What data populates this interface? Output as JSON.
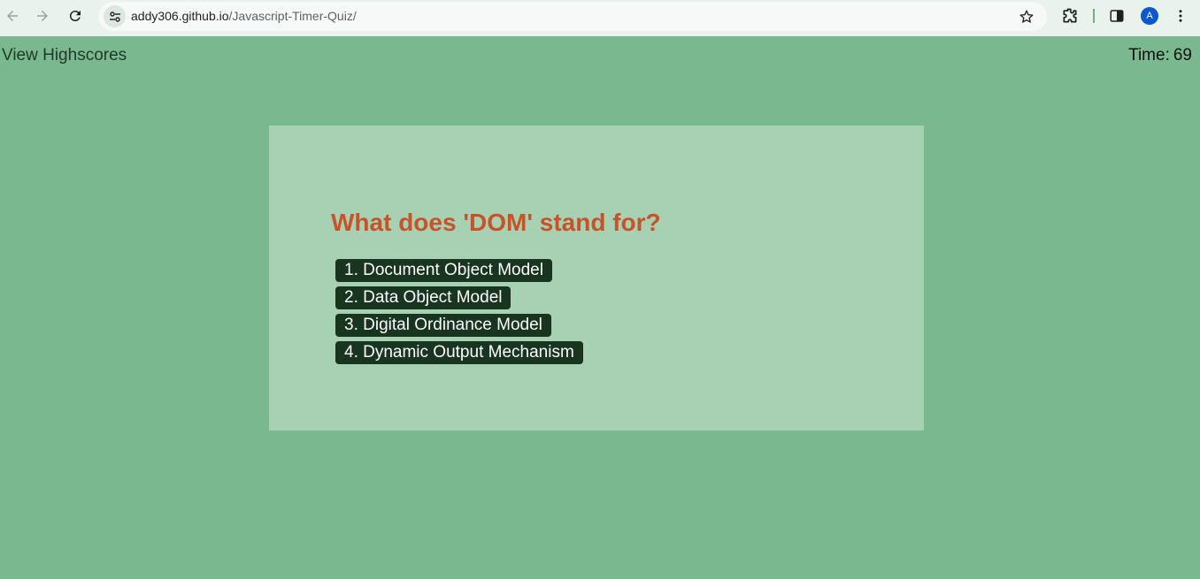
{
  "browser": {
    "url_host": "addy306.github.io",
    "url_path": "/Javascript-Timer-Quiz/",
    "avatar_letter": "A",
    "icons": [
      "back-arrow-icon",
      "forward-arrow-icon",
      "reload-icon",
      "site-info-icon",
      "bookmark-star-icon",
      "extensions-icon",
      "side-panel-icon",
      "profile-avatar",
      "more-menu-icon"
    ]
  },
  "header": {
    "highscores_link": "View Highscores",
    "timer_label": "Time:",
    "timer_value": "69"
  },
  "quiz": {
    "question": "What does 'DOM' stand for?",
    "choices": [
      "1. Document Object Model",
      "2. Data Object Model",
      "3. Digital Ordinance Model",
      "4. Dynamic Output Mechanism"
    ]
  },
  "colors": {
    "page_background": "#7ab88f",
    "card_background": "#a8d1b3",
    "question_text": "#c65329",
    "choice_button": "#18351f"
  }
}
